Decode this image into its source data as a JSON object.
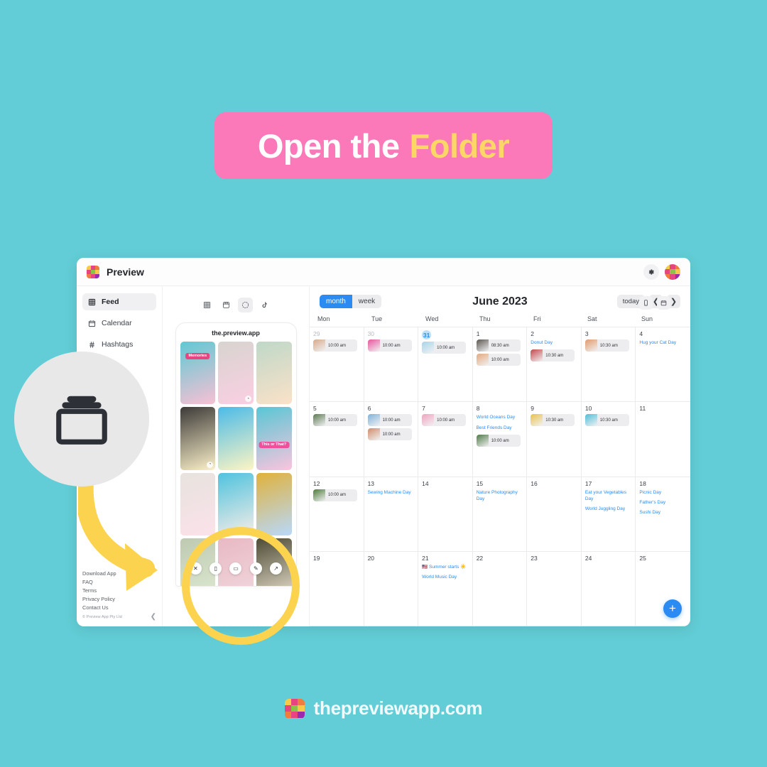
{
  "background_color": "#62CDD6",
  "banner": {
    "text_main": "Open the",
    "text_accent": "Folder",
    "bg_color": "#FB79B9",
    "main_color": "#FFFFFF",
    "accent_color": "#FCD765"
  },
  "app": {
    "brand_name": "Preview",
    "topbar_icons": [
      "gear-icon",
      "avatar"
    ],
    "sidebar": {
      "items": [
        {
          "label": "Feed",
          "icon": "grid-icon",
          "active": true
        },
        {
          "label": "Calendar",
          "icon": "calendar-icon",
          "active": false
        },
        {
          "label": "Hashtags",
          "icon": "hashtag-icon",
          "active": false
        },
        {
          "label": "",
          "icon": "chart-icon",
          "active": false
        }
      ],
      "footer_links": [
        "Download App",
        "FAQ",
        "Terms",
        "Privacy Policy",
        "Contact Us"
      ],
      "copyright": "© Preview App Pty Ltd",
      "collapse_icon": "chevron-left-icon"
    },
    "preview": {
      "view_tabs": [
        {
          "icon": "grid-icon",
          "active": false
        },
        {
          "icon": "reels-icon",
          "active": false
        },
        {
          "icon": "stories-circle-icon",
          "active": true
        },
        {
          "icon": "tiktok-icon",
          "active": false
        }
      ],
      "handle": "the.preview.app",
      "tiles": [
        {
          "bg": "#5FC9D3",
          "accent": "#E8447F",
          "label": "Memories",
          "badge": ""
        },
        {
          "bg": "#D8D4D0",
          "accent": "#F06FA8",
          "label": "",
          "badge": "clock"
        },
        {
          "bg": "#BFD8C8",
          "accent": "#F2A65A",
          "label": "",
          "badge": ""
        },
        {
          "bg": "#3C3A38",
          "accent": "#F4D35E",
          "label": "",
          "badge": "clock"
        },
        {
          "bg": "#4BBBE8",
          "accent": "#F9E04C",
          "label": "",
          "badge": ""
        },
        {
          "bg": "#57C7D4",
          "accent": "#F0509B",
          "label": "This or That?",
          "badge": ""
        },
        {
          "bg": "#E7E3DE",
          "accent": "#F4A6C0",
          "label": "",
          "badge": ""
        },
        {
          "bg": "#4FC3DE",
          "accent": "#E6C9B8",
          "label": "",
          "badge": ""
        },
        {
          "bg": "#E0B23C",
          "accent": "#2B8BF2",
          "label": "",
          "badge": ""
        },
        {
          "bg": "#BEC9B2",
          "accent": "#9FBF7A",
          "label": "",
          "badge": ""
        },
        {
          "bg": "#E8B9C4",
          "accent": "#D58A9C",
          "label": "",
          "badge": ""
        },
        {
          "bg": "#4D4A36",
          "accent": "#C8B37A",
          "label": "",
          "badge": ""
        }
      ],
      "action_buttons": [
        {
          "name": "close-icon",
          "glyph": "✕"
        },
        {
          "name": "trash-icon",
          "glyph": "▯"
        },
        {
          "name": "folder-icon",
          "glyph": "▭"
        },
        {
          "name": "edit-icon",
          "glyph": "✎"
        },
        {
          "name": "share-icon",
          "glyph": "↗"
        }
      ]
    },
    "calendar": {
      "view_month_label": "month",
      "view_week_label": "week",
      "active_view": "month",
      "title": "June 2023",
      "today_label": "today",
      "prev_icon": "chevron-left-icon",
      "next_icon": "chevron-right-icon",
      "mobile_icon": "mobile-icon",
      "calendar_icon": "calendar-icon",
      "add_label": "+",
      "accent_color": "#2B8BF2",
      "day_headers": [
        "Mon",
        "Tue",
        "Wed",
        "Thu",
        "Fri",
        "Sat",
        "Sun"
      ],
      "weeks": [
        [
          {
            "day": "29",
            "muted": true,
            "today": false,
            "posts": [
              {
                "time": "10:00 am",
                "thumb": "#D7A98A"
              }
            ],
            "events": []
          },
          {
            "day": "30",
            "muted": true,
            "today": false,
            "posts": [
              {
                "time": "10:00 am",
                "thumb": "#E8549E"
              }
            ],
            "events": []
          },
          {
            "day": "31",
            "muted": true,
            "today": true,
            "posts": [
              {
                "time": "10:00 am",
                "thumb": "#A7D4E8"
              }
            ],
            "events": []
          },
          {
            "day": "1",
            "muted": false,
            "today": false,
            "posts": [
              {
                "time": "08:30 am",
                "thumb": "#5A5550"
              },
              {
                "time": "10:00 am",
                "thumb": "#E3A87C"
              }
            ],
            "events": []
          },
          {
            "day": "2",
            "muted": false,
            "today": false,
            "posts": [
              {
                "time": "10:30 am",
                "thumb": "#C4484C"
              }
            ],
            "events": [
              "Donut Day"
            ]
          },
          {
            "day": "3",
            "muted": false,
            "today": false,
            "posts": [
              {
                "time": "10:30 am",
                "thumb": "#E09A6B"
              }
            ],
            "events": []
          },
          {
            "day": "4",
            "muted": false,
            "today": false,
            "posts": [],
            "events": [
              "Hug your Cat Day"
            ]
          }
        ],
        [
          {
            "day": "5",
            "muted": false,
            "today": false,
            "posts": [
              {
                "time": "10:00 am",
                "thumb": "#5C7A52"
              }
            ],
            "events": []
          },
          {
            "day": "6",
            "muted": false,
            "today": false,
            "posts": [
              {
                "time": "10:00 am",
                "thumb": "#7FB2D8"
              },
              {
                "time": "10:00 am",
                "thumb": "#D08C6A"
              }
            ],
            "events": []
          },
          {
            "day": "7",
            "muted": false,
            "today": false,
            "posts": [
              {
                "time": "10:00 am",
                "thumb": "#F0A3BE"
              }
            ],
            "events": []
          },
          {
            "day": "8",
            "muted": false,
            "today": false,
            "posts": [
              {
                "time": "10:00 am",
                "thumb": "#4E7A45"
              }
            ],
            "events": [
              "World Oceans Day",
              "Best Friends Day"
            ]
          },
          {
            "day": "9",
            "muted": false,
            "today": false,
            "posts": [
              {
                "time": "10:30 am",
                "thumb": "#E8C24A"
              }
            ],
            "events": []
          },
          {
            "day": "10",
            "muted": false,
            "today": false,
            "posts": [
              {
                "time": "10:30 am",
                "thumb": "#4FBDD8"
              }
            ],
            "events": []
          },
          {
            "day": "11",
            "muted": false,
            "today": false,
            "posts": [],
            "events": []
          }
        ],
        [
          {
            "day": "12",
            "muted": false,
            "today": false,
            "posts": [
              {
                "time": "10:00 am",
                "thumb": "#4C7A3A"
              }
            ],
            "events": []
          },
          {
            "day": "13",
            "muted": false,
            "today": false,
            "posts": [],
            "events": [
              "Sewing Machine Day"
            ]
          },
          {
            "day": "14",
            "muted": false,
            "today": false,
            "posts": [],
            "events": []
          },
          {
            "day": "15",
            "muted": false,
            "today": false,
            "posts": [],
            "events": [
              "Nature Photography Day"
            ]
          },
          {
            "day": "16",
            "muted": false,
            "today": false,
            "posts": [],
            "events": []
          },
          {
            "day": "17",
            "muted": false,
            "today": false,
            "posts": [],
            "events": [
              "Eat your Vegetables Day",
              "World Juggling Day"
            ]
          },
          {
            "day": "18",
            "muted": false,
            "today": false,
            "posts": [],
            "events": [
              "Picnic Day",
              "Father's Day",
              "Sushi Day"
            ]
          }
        ],
        [
          {
            "day": "19",
            "muted": false,
            "today": false,
            "posts": [],
            "events": []
          },
          {
            "day": "20",
            "muted": false,
            "today": false,
            "posts": [],
            "events": []
          },
          {
            "day": "21",
            "muted": false,
            "today": false,
            "posts": [],
            "events": [
              "🇺🇸 Summer starts ☀️",
              "World Music Day"
            ]
          },
          {
            "day": "22",
            "muted": false,
            "today": false,
            "posts": [],
            "events": []
          },
          {
            "day": "23",
            "muted": false,
            "today": false,
            "posts": [],
            "events": []
          },
          {
            "day": "24",
            "muted": false,
            "today": false,
            "posts": [],
            "events": []
          },
          {
            "day": "25",
            "muted": false,
            "today": false,
            "posts": [],
            "events": []
          }
        ]
      ]
    }
  },
  "callout": {
    "icon": "folder-stack-icon",
    "circle_color": "#E8E8E8",
    "arrow_color": "#FBD34F",
    "highlight_ring_color": "#FBD34F"
  },
  "footer": {
    "url": "thepreviewapp.com",
    "url_color": "#EFFAFA",
    "logo": "preview-logo"
  }
}
